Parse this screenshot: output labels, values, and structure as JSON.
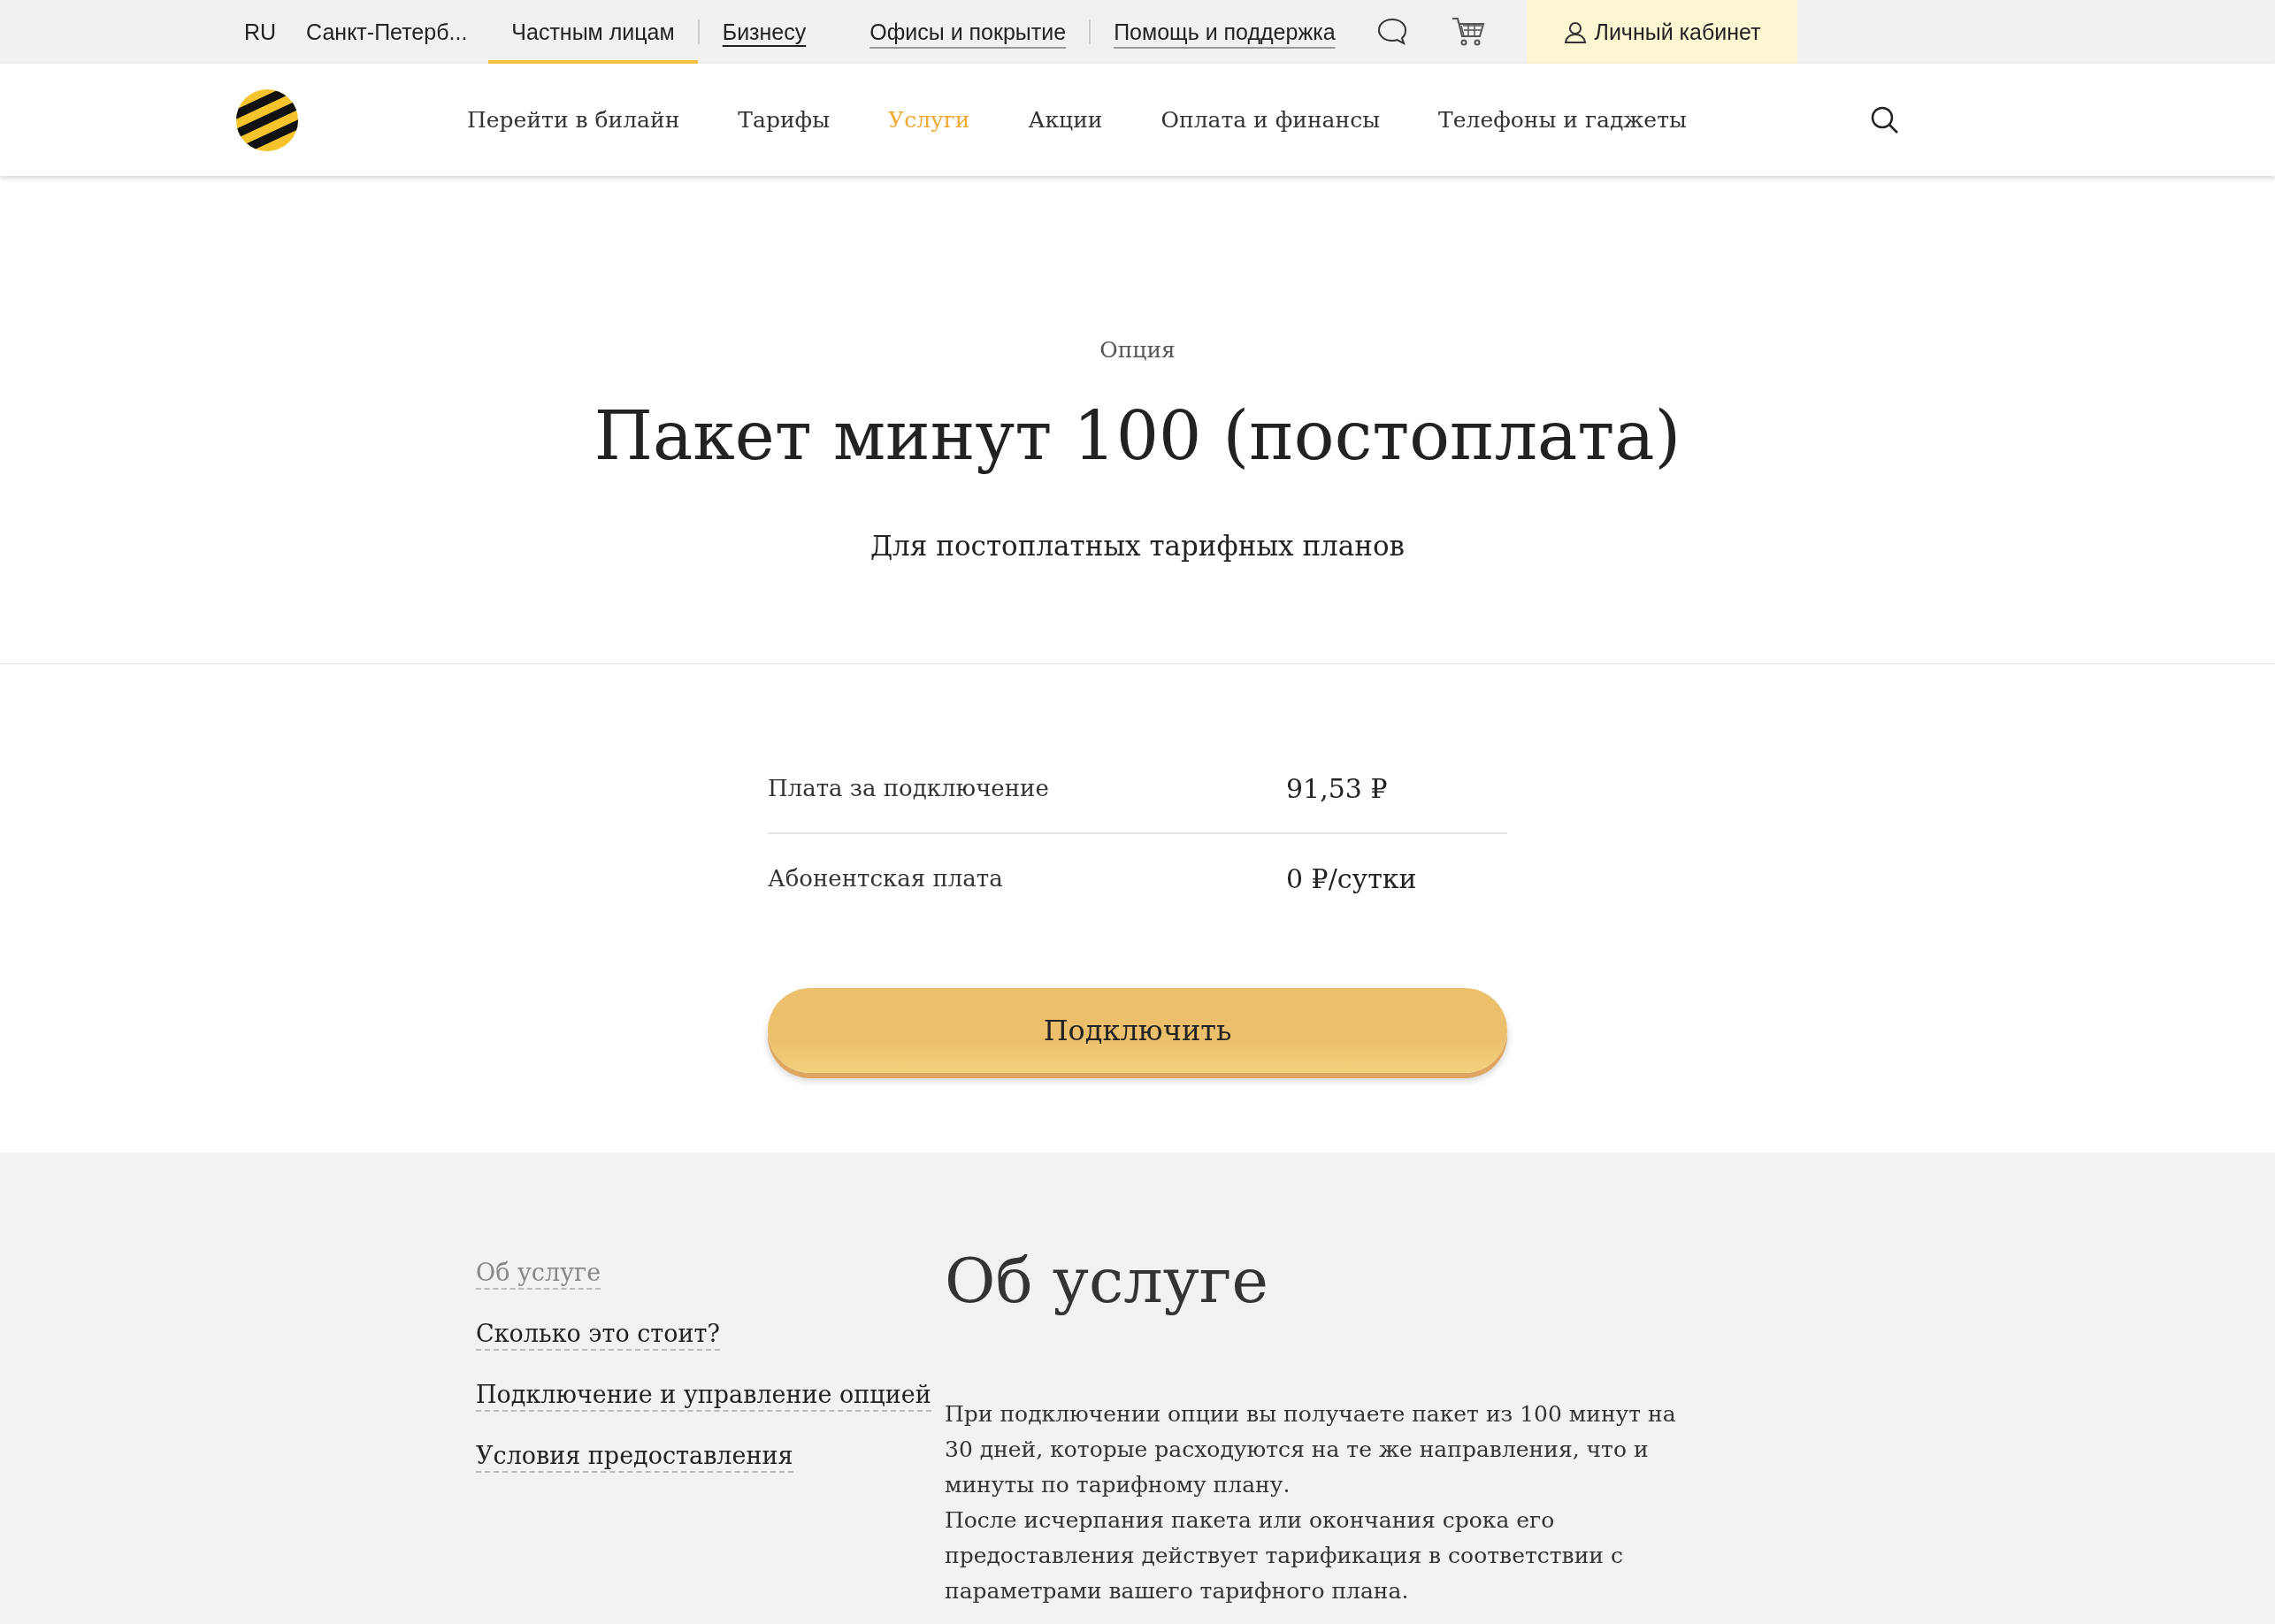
{
  "top_bar": {
    "language": "RU",
    "city": "Санкт-Петерб...",
    "segments": [
      {
        "label": "Частным лицам",
        "selected": true
      },
      {
        "label": "Бизнесу",
        "selected": false
      }
    ],
    "links": [
      "Офисы и покрытие",
      "Помощь и поддержка"
    ],
    "account_button": "Личный кабинет"
  },
  "main_nav": {
    "items": [
      {
        "label": "Перейти в билайн",
        "selected": false
      },
      {
        "label": "Тарифы",
        "selected": false
      },
      {
        "label": "Услуги",
        "selected": true
      },
      {
        "label": "Акции",
        "selected": false
      },
      {
        "label": "Оплата и финансы",
        "selected": false
      },
      {
        "label": "Телефоны и гаджеты",
        "selected": false
      }
    ]
  },
  "hero": {
    "eyebrow": "Опция",
    "title": "Пакет минут 100 (постоплата)",
    "subtitle": "Для постоплатных тарифных планов"
  },
  "prices": [
    {
      "label": "Плата за подключение",
      "value": "91,53 ₽"
    },
    {
      "label": "Абонентская плата",
      "value": "0 ₽/сутки"
    }
  ],
  "connect_button": "Подключить",
  "sidebar": {
    "items": [
      {
        "label": "Об услуге",
        "selected": true
      },
      {
        "label": "Сколько это стоит?",
        "selected": false
      },
      {
        "label": "Подключение и управление опцией",
        "selected": false
      },
      {
        "label": "Условия предоставления",
        "selected": false
      }
    ]
  },
  "about": {
    "heading": "Об услуге",
    "paragraphs": [
      "При подключении опции вы получаете пакет из 100 минут на 30 дней, которые расходуются на те же направления, что и минуты по тарифному плану.",
      "После исчерпания пакета или окончания срока его предоставления действует тарификация в соответствии с параметрами вашего тарифного плана."
    ]
  }
}
